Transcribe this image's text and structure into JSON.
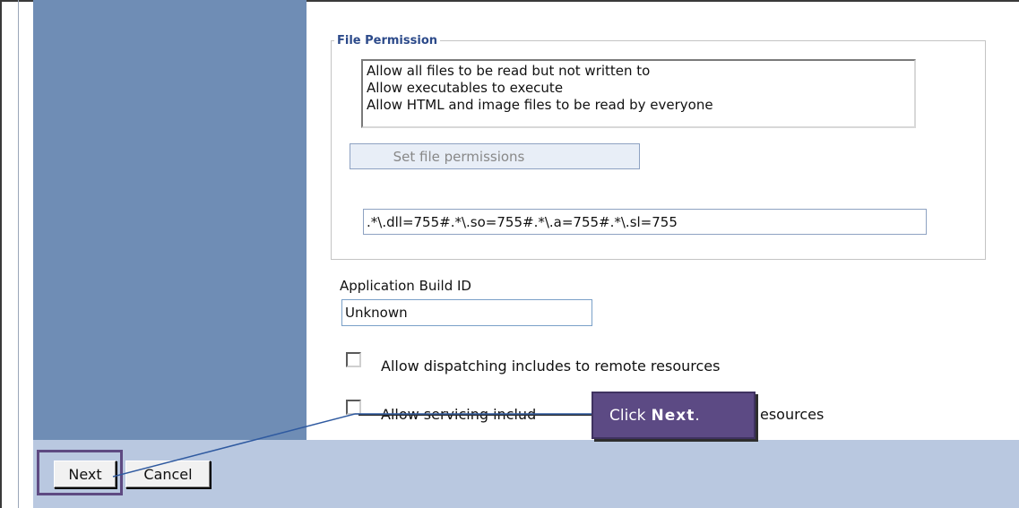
{
  "file_permission": {
    "legend": "File Permission",
    "list_items": [
      "Allow all files to be read but not written to",
      "Allow executables to execute",
      "Allow HTML and image files to be read by everyone"
    ],
    "set_button_label": "Set file permissions",
    "permissions_value": ".*\\.dll=755#.*\\.so=755#.*\\.a=755#.*\\.sl=755"
  },
  "build": {
    "label": "Application Build ID",
    "value": "Unknown"
  },
  "options": [
    {
      "label": "Allow dispatching includes to remote resources",
      "checked": false
    },
    {
      "label_left": "Allow servicing includ",
      "label_right": "esources",
      "checked": false
    }
  ],
  "footer": {
    "next_label": "Next",
    "cancel_label": "Cancel"
  },
  "callout": {
    "prefix": "Click",
    "bold": "Next",
    "suffix": "."
  },
  "colors": {
    "sidebar": "#6f8db5",
    "footer": "#b9c8e0",
    "callout": "#5c4a84",
    "legend": "#2c4a8a"
  }
}
